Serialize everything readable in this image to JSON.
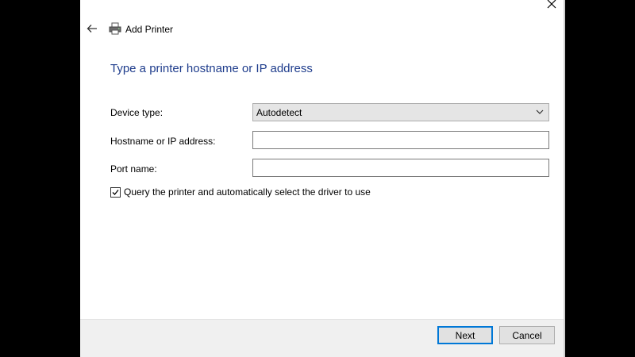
{
  "window": {
    "title": "Add Printer",
    "close_icon": "close-icon",
    "back_icon": "back-arrow-icon",
    "app_icon": "printer-icon"
  },
  "page": {
    "heading": "Type a printer hostname or IP address"
  },
  "form": {
    "device_type_label": "Device type:",
    "device_type_value": "Autodetect",
    "hostname_label": "Hostname or IP address:",
    "hostname_value": "",
    "port_label": "Port name:",
    "port_value": "",
    "query_checkbox_label": "Query the printer and automatically select the driver to use",
    "query_checked": true
  },
  "buttons": {
    "next": "Next",
    "cancel": "Cancel"
  },
  "colors": {
    "heading": "#1e3c8c",
    "default_button_border": "#0078d7",
    "footer_bg": "#f0f0f0"
  }
}
